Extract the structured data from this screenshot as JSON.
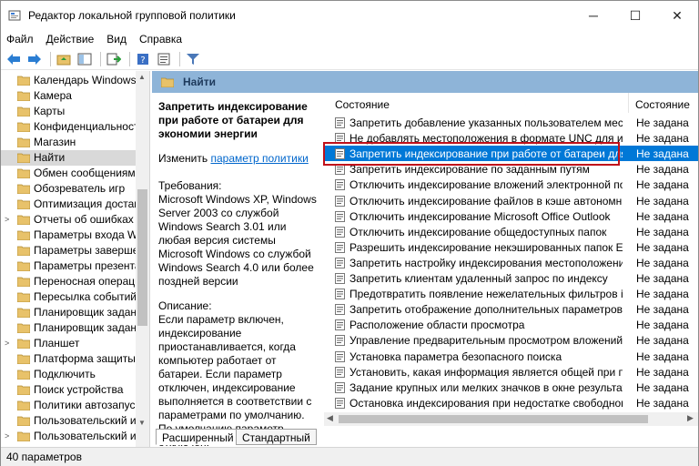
{
  "window": {
    "title": "Редактор локальной групповой политики",
    "minimize_glyph": "─",
    "maximize_glyph": "☐",
    "close_glyph": "✕"
  },
  "menu": [
    "Файл",
    "Действие",
    "Вид",
    "Справка"
  ],
  "toolbar": {
    "icons": [
      "back-arrow-icon",
      "forward-arrow-icon",
      "up-folder-icon",
      "show-hide-tree-icon",
      "export-list-icon",
      "help-icon",
      "properties-icon",
      "filter-icon"
    ]
  },
  "tree": {
    "items": [
      {
        "label": "Календарь Windows",
        "has_children": false,
        "selected": false
      },
      {
        "label": "Камера",
        "has_children": false,
        "selected": false
      },
      {
        "label": "Карты",
        "has_children": false,
        "selected": false
      },
      {
        "label": "Конфиденциальность",
        "has_children": false,
        "selected": false
      },
      {
        "label": "Магазин",
        "has_children": false,
        "selected": false
      },
      {
        "label": "Найти",
        "has_children": false,
        "selected": true
      },
      {
        "label": "Обмен сообщениями",
        "has_children": false,
        "selected": false
      },
      {
        "label": "Обозреватель игр",
        "has_children": false,
        "selected": false
      },
      {
        "label": "Оптимизация доставки",
        "has_children": false,
        "selected": false
      },
      {
        "label": "Отчеты об ошибках Windows",
        "has_children": true,
        "selected": false
      },
      {
        "label": "Параметры входа Windows",
        "has_children": false,
        "selected": false
      },
      {
        "label": "Параметры завершения",
        "has_children": false,
        "selected": false
      },
      {
        "label": "Параметры презентации",
        "has_children": false,
        "selected": false
      },
      {
        "label": "Переносная операционная",
        "has_children": false,
        "selected": false
      },
      {
        "label": "Пересылка событий",
        "has_children": false,
        "selected": false
      },
      {
        "label": "Планировщик заданий",
        "has_children": false,
        "selected": false
      },
      {
        "label": "Планировщик заданий",
        "has_children": false,
        "selected": false
      },
      {
        "label": "Планшет",
        "has_children": true,
        "selected": false
      },
      {
        "label": "Платформа защиты пр",
        "has_children": false,
        "selected": false
      },
      {
        "label": "Подключить",
        "has_children": false,
        "selected": false
      },
      {
        "label": "Поиск устройства",
        "has_children": false,
        "selected": false
      },
      {
        "label": "Политики автозапуска",
        "has_children": false,
        "selected": false
      },
      {
        "label": "Пользовательский инт",
        "has_children": false,
        "selected": false
      },
      {
        "label": "Пользовательский инт",
        "has_children": true,
        "selected": false
      }
    ]
  },
  "panel": {
    "header": "Найти",
    "desc_title": "Запретить индексирование при работе от батареи для экономии энергии",
    "edit_prefix": "Изменить ",
    "edit_link": "параметр политики",
    "req_heading": "Требования:",
    "req_text": "Microsoft Windows XP, Windows Server 2003 со службой Windows Search 3.01 или любая версия системы Microsoft Windows со службой Windows Search 4.0 или более поздней версии",
    "desc_heading": "Описание:",
    "desc_text": "Если параметр включен, индексирование приостанавливается, когда компьютер работает от батареи. Если параметр отключен, индексирование выполняется в соответствии с параметрами по умолчанию. По умолчанию параметр отключен."
  },
  "list": {
    "col_name": "Состояние",
    "col_state": "Состояние",
    "rows": [
      {
        "name": "Запретить добавление указанных пользователем местоп...",
        "state": "Не задана",
        "selected": false
      },
      {
        "name": "Не добавлять местоположения в формате UNC для инде...",
        "state": "Не задана",
        "selected": false
      },
      {
        "name": "Запретить индексирование при работе от батареи для эк...",
        "state": "Не задана",
        "selected": true
      },
      {
        "name": "Запретить индексирование по заданным путям",
        "state": "Не задана",
        "selected": false
      },
      {
        "name": "Отключить индексирование вложений электронной поч...",
        "state": "Не задана",
        "selected": false
      },
      {
        "name": "Отключить индексирование файлов в кэше автономных...",
        "state": "Не задана",
        "selected": false
      },
      {
        "name": "Отключить индексирование Microsoft Office Outlook",
        "state": "Не задана",
        "selected": false
      },
      {
        "name": "Отключить индексирование общедоступных папок",
        "state": "Не задана",
        "selected": false
      },
      {
        "name": "Разрешить индексирование некэшированных папок Exch...",
        "state": "Не задана",
        "selected": false
      },
      {
        "name": "Запретить настройку индексирования местоположени...",
        "state": "Не задана",
        "selected": false
      },
      {
        "name": "Запретить клиентам удаленный запрос по индексу",
        "state": "Не задана",
        "selected": false
      },
      {
        "name": "Предотвратить появление нежелательных фильтров iFilt...",
        "state": "Не задана",
        "selected": false
      },
      {
        "name": "Запретить отображение дополнительных параметров ин...",
        "state": "Не задана",
        "selected": false
      },
      {
        "name": "Расположение области просмотра",
        "state": "Не задана",
        "selected": false
      },
      {
        "name": "Управление предварительным просмотром вложений",
        "state": "Не задана",
        "selected": false
      },
      {
        "name": "Установка параметра безопасного поиска",
        "state": "Не задана",
        "selected": false
      },
      {
        "name": "Установить, какая информация является общей при поис...",
        "state": "Не задана",
        "selected": false
      },
      {
        "name": "Задание крупных или мелких значков в окне результатов...",
        "state": "Не задана",
        "selected": false
      },
      {
        "name": "Остановка индексирования при недостатке свободного ...",
        "state": "Не задана",
        "selected": false
      }
    ]
  },
  "tabs": [
    "Расширенный",
    "Стандартный"
  ],
  "status": "40 параметров",
  "colors": {
    "header_band": "#8eb4d8",
    "selection": "#0078d7",
    "highlight_box": "#c0101a",
    "link": "#0066cc",
    "folder": "#e8c26a"
  }
}
